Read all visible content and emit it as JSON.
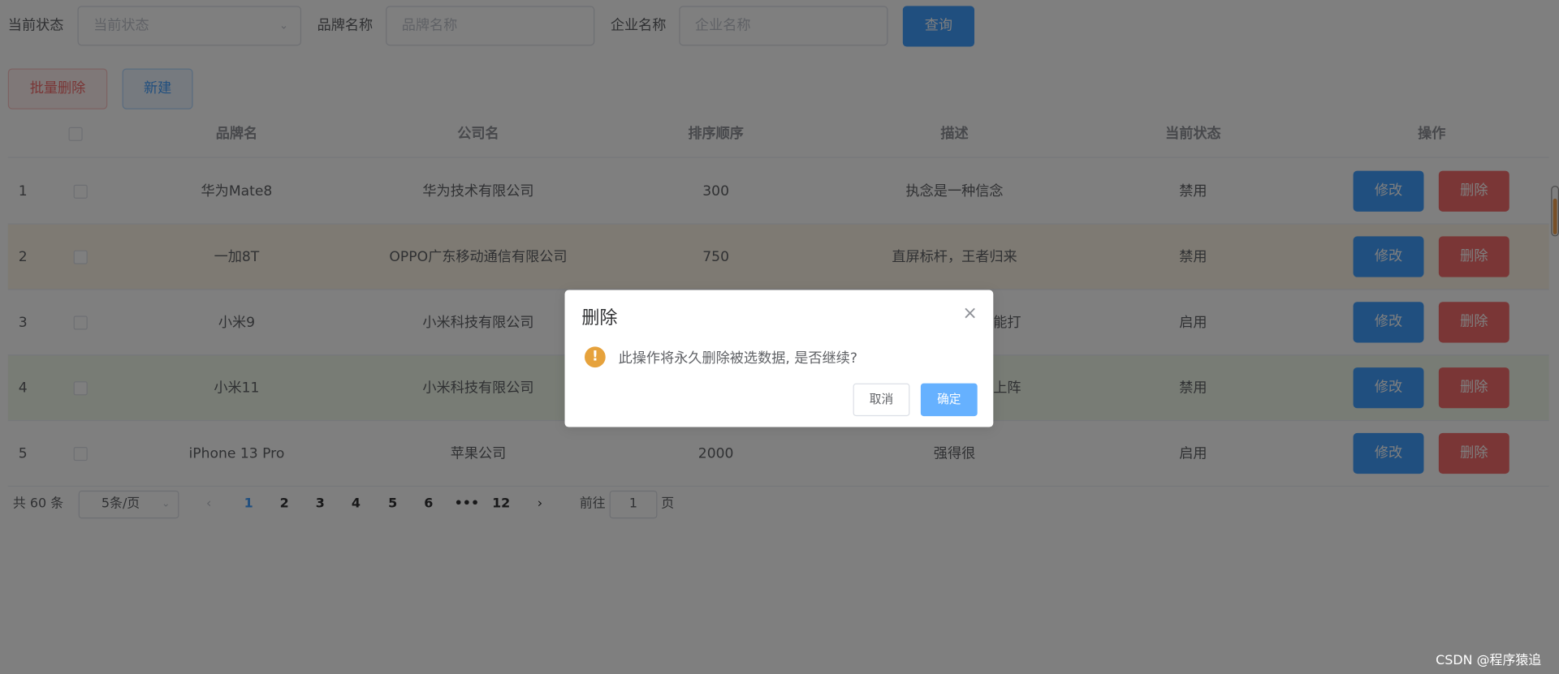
{
  "filters": {
    "status": {
      "label": "当前状态",
      "placeholder": "当前状态"
    },
    "brand": {
      "label": "品牌名称",
      "placeholder": "品牌名称"
    },
    "company": {
      "label": "企业名称",
      "placeholder": "企业名称"
    },
    "query_label": "查询"
  },
  "actions": {
    "batch_delete_label": "批量删除",
    "new_label": "新建"
  },
  "table": {
    "headers": [
      "品牌名",
      "公司名",
      "排序顺序",
      "描述",
      "当前状态",
      "操作"
    ],
    "rows": [
      {
        "index": "1",
        "brand": "华为Mate8",
        "company": "华为技术有限公司",
        "order": "300",
        "desc": "执念是一种信念",
        "status": "禁用",
        "edit": "修改",
        "del": "删除"
      },
      {
        "index": "2",
        "brand": "一加8T",
        "company": "OPPO广东移动通信有限公司",
        "order": "750",
        "desc": "直屏标杆，王者归来",
        "status": "禁用",
        "edit": "修改",
        "del": "删除"
      },
      {
        "index": "3",
        "brand": "小米9",
        "company": "小米科技有限公司",
        "order": "",
        "desc": "能打",
        "status": "启用",
        "edit": "修改",
        "del": "删除"
      },
      {
        "index": "4",
        "brand": "小米11",
        "company": "小米科技有限公司",
        "order": "",
        "desc": "上阵",
        "status": "禁用",
        "edit": "修改",
        "del": "删除"
      },
      {
        "index": "5",
        "brand": "iPhone 13 Pro",
        "company": "苹果公司",
        "order": "2000",
        "desc": "强得很",
        "status": "启用",
        "edit": "修改",
        "del": "删除"
      }
    ],
    "row_colors": {
      "warning": "#fdf5e6",
      "success": "#f0f9eb"
    }
  },
  "pagination": {
    "total": "共 60 条",
    "page_size": "5条/页",
    "pages": [
      "1",
      "2",
      "3",
      "4",
      "5",
      "6",
      "•••",
      "12"
    ],
    "current": "1",
    "goto_label": "前往",
    "goto_value": "1",
    "page_suffix": "页"
  },
  "dialog": {
    "title": "删除",
    "message": "此操作将永久删除被选数据, 是否继续?",
    "cancel": "取消",
    "confirm": "确定",
    "icon": "warning-icon"
  },
  "watermark": "CSDN @程序猿追",
  "colors": {
    "primary": "#409eff",
    "danger": "#f56c6c",
    "warning": "#e6a23c"
  }
}
